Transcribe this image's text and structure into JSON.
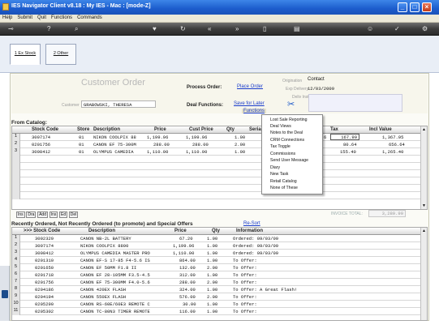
{
  "window": {
    "title": "IES Navigator Client v8.18 : My IES - Mac :          [mode-Z]",
    "controls": [
      "_",
      "□",
      "×"
    ]
  },
  "menu": {
    "items": [
      "Help",
      "Submit",
      "Quit",
      "Functions",
      "Commands"
    ]
  },
  "toolbar": {
    "icons": [
      "key-icon",
      "help-icon",
      "search-icon",
      "heart-icon",
      "refresh-icon",
      "back-icon",
      "forward-icon",
      "copy-icon",
      "paste-icon",
      "users-icon",
      "check-icon",
      "gear-icon"
    ]
  },
  "tabs": [
    {
      "label": "1 Ex Stock"
    },
    {
      "label": "2 Other"
    }
  ],
  "form": {
    "title": "Customer Order",
    "customer_label": "Customer",
    "customer_value": "GRABOWSKI, THERESA",
    "process_order_label": "Process Order:",
    "process_order_link": "Place Order",
    "deal_functions_label": "Deal Functions:",
    "save_for_later_link": "Save for Later",
    "functions_link": "Functions",
    "origination_label": "Origination",
    "origination_value": "Contact",
    "exp_delivery_label": "Exp Delivery",
    "exp_delivery_value": "12/03/2009",
    "deliv_instr_label": "Deliv Instr"
  },
  "catalog": {
    "section_label": "From Catalog:",
    "columns": [
      "Stock Code",
      "Store",
      "Description",
      "Price",
      "Cust Price",
      "Qty",
      "Serial",
      "Tax",
      "Incl Value"
    ],
    "rows": [
      {
        "n": "1",
        "code": "3007174",
        "store": "01",
        "desc": "NIKON COOLPIX 88",
        "price": "1,199.96",
        "cust": "1,199.96",
        "qty": "1.00",
        "taxcode": "6",
        "tax": "167.99",
        "incl": "1,367.95"
      },
      {
        "n": "2",
        "code": "0201756",
        "store": "01",
        "desc": "CANON EF 75-300M",
        "price": "288.00",
        "cust": "288.00",
        "qty": "2.00",
        "taxcode": "",
        "tax": "80.64",
        "incl": "656.64"
      },
      {
        "n": "3",
        "code": "3008412",
        "store": "01",
        "desc": "OLYMPUS CAMEDIA",
        "price": "1,110.00",
        "cust": "1,110.00",
        "qty": "1.00",
        "taxcode": "",
        "tax": "155.40",
        "incl": "1,265.40"
      }
    ],
    "buttons": [
      "Ins",
      "Dra",
      "Add",
      "Ins",
      "Ed",
      "Del"
    ],
    "invoice_total_label": "INVOICE TOTAL:",
    "invoice_total_value": "3,289.99"
  },
  "context_menu": {
    "items": [
      "Lost Sale Reporting",
      "Deal Views",
      "Notes to the Deal",
      "CRM Connections",
      "Tax Toggle",
      "Commissions",
      "Send User Message",
      "Diary",
      "New Task",
      "Retail Catalog",
      "None of These"
    ]
  },
  "recent": {
    "section_label": "Recently Ordered, Not Recently Ordered (to promote) and Special Offers",
    "resort_link": "Re-Sort",
    "columns": [
      ">>> Stock Code",
      "Description",
      "Price",
      "Qty",
      "Information"
    ],
    "rows": [
      {
        "n": "1",
        "code": "3002329",
        "desc": "CANON NB-2L BATTERY",
        "price": "67.20",
        "qty": "1.00",
        "info": "Ordered: 09/03/09"
      },
      {
        "n": "2",
        "code": "3007174",
        "desc": "NIKON COOLPIX 8800",
        "price": "1,199.96",
        "qty": "1.00",
        "info": "Ordered: 09/03/09"
      },
      {
        "n": "3",
        "code": "3008412",
        "desc": "OLYMPUS CAMEDIA MASTER PRO",
        "price": "1,110.00",
        "qty": "1.00",
        "info": "Ordered: 09/03/09"
      },
      {
        "n": "4",
        "code": "0201310",
        "desc": "CANON EF-S 17-85 F4-5.6 IS",
        "price": "864.00",
        "qty": "1.00",
        "info": "To Offer:"
      },
      {
        "n": "5",
        "code": "0201650",
        "desc": "CANON EF 50MM F1.8 II",
        "price": "132.00",
        "qty": "2.00",
        "info": "To Offer:"
      },
      {
        "n": "6",
        "code": "0201718",
        "desc": "CANON EF 28-105MM F3.5-4.5",
        "price": "312.00",
        "qty": "1.00",
        "info": "To Offer:"
      },
      {
        "n": "7",
        "code": "0201756",
        "desc": "CANON EF 75-300MM F4.0-5.6",
        "price": "288.00",
        "qty": "2.00",
        "info": "To Offer:"
      },
      {
        "n": "8",
        "code": "0204186",
        "desc": "CANON 420EX FLASH",
        "price": "324.00",
        "qty": "1.00",
        "info": "To Offer: A Great Flash!"
      },
      {
        "n": "9",
        "code": "0204194",
        "desc": "CANON 550EX FLASH",
        "price": "576.00",
        "qty": "2.00",
        "info": "To Offer:"
      },
      {
        "n": "10",
        "code": "0205290",
        "desc": "CANON RS-60E/60E3 REMOTE C",
        "price": "30.00",
        "qty": "1.00",
        "info": "To Offer:"
      },
      {
        "n": "11",
        "code": "0205302",
        "desc": "CANON TC-80N3 TIMER REMOTE",
        "price": "116.00",
        "qty": "1.00",
        "info": "To Offer:"
      }
    ]
  }
}
